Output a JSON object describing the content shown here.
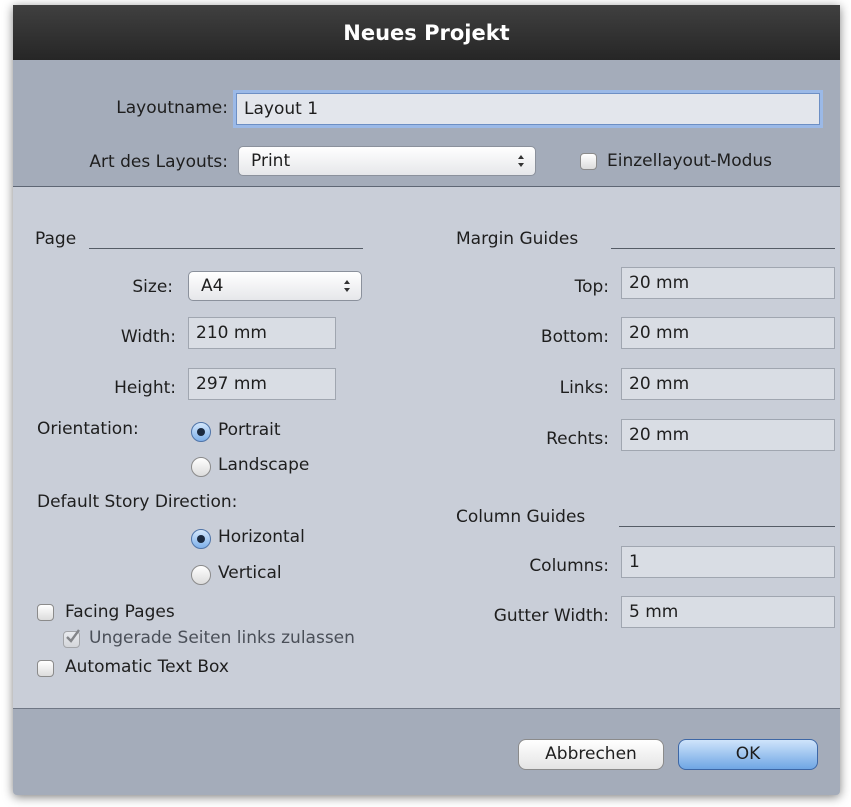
{
  "window": {
    "title": "Neues Projekt"
  },
  "layout": {
    "name_label": "Layoutname:",
    "name_value": "Layout 1",
    "type_label": "Art des Layouts:",
    "type_value": "Print",
    "single_layout_mode_label": "Einzellayout-Modus",
    "single_layout_mode_checked": false
  },
  "page": {
    "heading": "Page",
    "size_label": "Size:",
    "size_value": "A4",
    "width_label": "Width:",
    "width_value": "210 mm",
    "height_label": "Height:",
    "height_value": "297 mm",
    "orientation_label": "Orientation:",
    "orientation_options": [
      {
        "label": "Portrait",
        "selected": true
      },
      {
        "label": "Landscape",
        "selected": false
      }
    ],
    "story_direction_label": "Default Story Direction:",
    "story_direction_options": [
      {
        "label": "Horizontal",
        "selected": true
      },
      {
        "label": "Vertical",
        "selected": false
      }
    ],
    "facing_pages_label": "Facing Pages",
    "facing_pages_checked": false,
    "odd_pages_left_label": "Ungerade Seiten links zulassen",
    "odd_pages_left_checked": true,
    "odd_pages_left_disabled": true,
    "auto_text_box_label": "Automatic Text Box",
    "auto_text_box_checked": false
  },
  "margins": {
    "heading": "Margin Guides",
    "top_label": "Top:",
    "top_value": "20 mm",
    "bottom_label": "Bottom:",
    "bottom_value": "20 mm",
    "left_label": "Links:",
    "left_value": "20 mm",
    "right_label": "Rechts:",
    "right_value": "20 mm"
  },
  "columns": {
    "heading": "Column Guides",
    "columns_label": "Columns:",
    "columns_value": "1",
    "gutter_label": "Gutter Width:",
    "gutter_value": "5 mm"
  },
  "buttons": {
    "cancel": "Abbrechen",
    "ok": "OK"
  },
  "colors": {
    "accent": "#6fa6e4",
    "focus_ring": "#9bb9e7",
    "title_bar": "#2e2e2e"
  }
}
